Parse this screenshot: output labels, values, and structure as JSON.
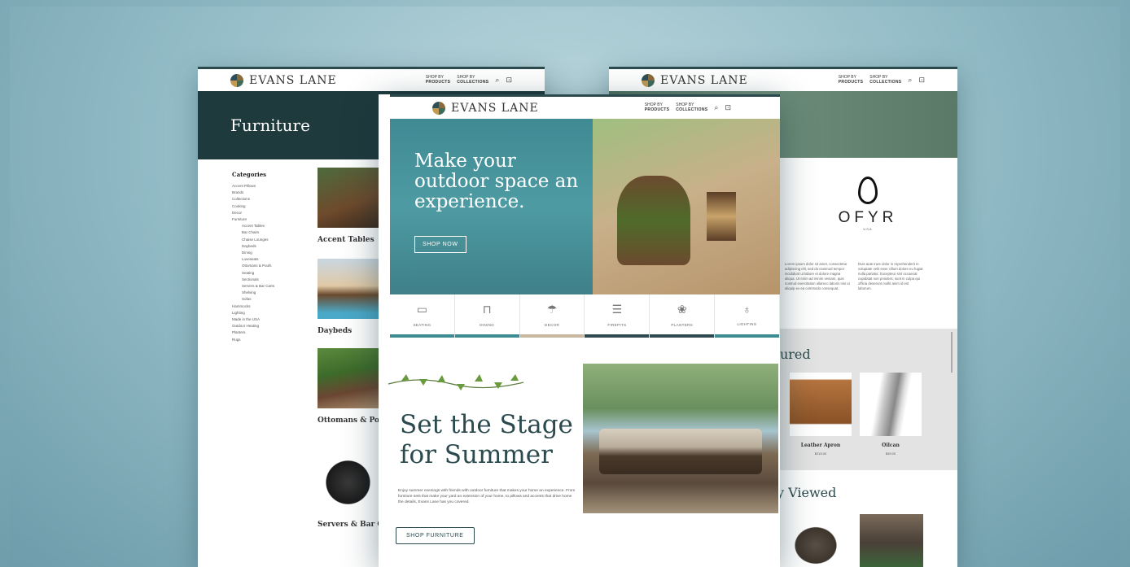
{
  "brand": "EVANS LANE",
  "nav": {
    "products_top": "SHOP BY",
    "products": "PRODUCTS",
    "collections_top": "SHOP BY",
    "collections": "COLLECTIONS"
  },
  "left_page": {
    "hero_title": "Furniture",
    "categories_head": "Categories",
    "categories": [
      {
        "label": "Accent Pillows",
        "sub": false
      },
      {
        "label": "Brands",
        "sub": false
      },
      {
        "label": "Collections",
        "sub": false
      },
      {
        "label": "Cooking",
        "sub": false
      },
      {
        "label": "Decor",
        "sub": false
      },
      {
        "label": "Furniture",
        "sub": false
      },
      {
        "label": "Accent Tables",
        "sub": true
      },
      {
        "label": "Bar Chairs",
        "sub": true
      },
      {
        "label": "Chaise Lounges",
        "sub": true
      },
      {
        "label": "Daybeds",
        "sub": true
      },
      {
        "label": "Dining",
        "sub": true
      },
      {
        "label": "Loveseats",
        "sub": true
      },
      {
        "label": "Ottomans & Poufs",
        "sub": true
      },
      {
        "label": "Seating",
        "sub": true
      },
      {
        "label": "Sectionals",
        "sub": true
      },
      {
        "label": "Servers & Bar Carts",
        "sub": true
      },
      {
        "label": "Shelving",
        "sub": true
      },
      {
        "label": "Sofas",
        "sub": true
      },
      {
        "label": "Hammocks",
        "sub": false
      },
      {
        "label": "Lighting",
        "sub": false
      },
      {
        "label": "Made in the USA",
        "sub": false
      },
      {
        "label": "Outdoor Heating",
        "sub": false
      },
      {
        "label": "Planters",
        "sub": false
      },
      {
        "label": "Rugs",
        "sub": false
      }
    ],
    "tiles": [
      "Accent Tables",
      "Daybeds",
      "Ottomans & Poufs",
      "Servers & Bar Carts"
    ]
  },
  "center_page": {
    "headline": "Make your outdoor space an experience.",
    "hero_button": "SHOP NOW",
    "categories": [
      {
        "label": "SEATING",
        "icon": "sofa-icon",
        "glyph": "▭",
        "bar": "#3d8b93"
      },
      {
        "label": "DINING",
        "icon": "table-icon",
        "glyph": "⊓",
        "bar": "#3d8b93"
      },
      {
        "label": "DECOR",
        "icon": "umbrella-icon",
        "glyph": "☂",
        "bar": "#c7b79f"
      },
      {
        "label": "FIREPITS",
        "icon": "firepit-icon",
        "glyph": "☰",
        "bar": "#2e4a4f"
      },
      {
        "label": "PLANTERS",
        "icon": "planter-icon",
        "glyph": "❀",
        "bar": "#2e4a4f"
      },
      {
        "label": "LIGHTING",
        "icon": "lantern-icon",
        "glyph": "♁",
        "bar": "#3d8b93"
      }
    ],
    "feature_title": "Set the Stage for Summer",
    "feature_body": "Enjoy summer evenings with friends with outdoor furniture that makes your home an experience. From furniture sets that make your yard an extension of your home, to pillows and accents that drive home the details, Evans Lane has you covered.",
    "feature_button": "SHOP FURNITURE"
  },
  "right_page": {
    "brand_name": "OFYR",
    "brand_sub": "USA",
    "lorem_left": "Lorem ipsum dolor sit amet, consectetur adipiscing elit, sed do eiusmod tempor incididunt ut labore et dolore magna aliqua. Ut enim ad minim veniam, quis nostrud exercitation ullamco laboris nisi ut aliquip ex ea commodo consequat.",
    "lorem_right": "Duis aute irure dolor in reprehenderit in voluptate velit esse cillum dolore eu fugiat nulla pariatur. Excepteur sint occaecat cupidatat non proident, sunt in culpa qui officia deserunt mollit anim id est laborum.",
    "featured_title": "atured",
    "products": [
      {
        "name": "Leather Apron",
        "price": "$215.00"
      },
      {
        "name": "Oilcan",
        "price": "$39.00"
      }
    ],
    "viewed_title": "y Viewed"
  }
}
